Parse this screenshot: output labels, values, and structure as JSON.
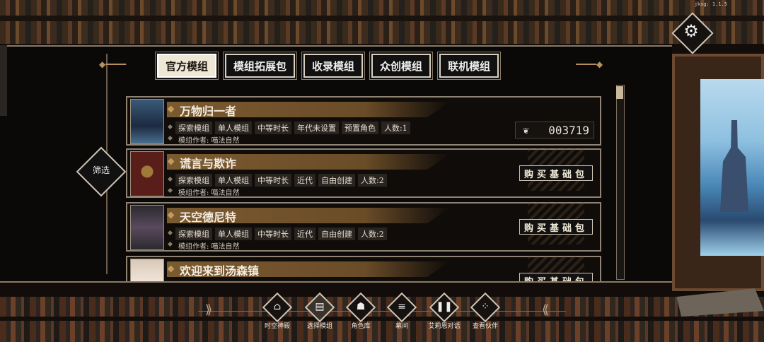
{
  "version": "jksg: 1.1.5",
  "tabs": [
    {
      "label": "官方模组",
      "active": true
    },
    {
      "label": "模组拓展包",
      "active": false
    },
    {
      "label": "收录模组",
      "active": false
    },
    {
      "label": "众创模组",
      "active": false
    },
    {
      "label": "联机模组",
      "active": false
    }
  ],
  "filter_label": "筛选",
  "modules": [
    {
      "title": "万物归一者",
      "tags": [
        "探索模组",
        "单人模组",
        "中等时长",
        "年代未设置",
        "预置角色",
        "人数:1"
      ],
      "author": "模组作者: 喵法自然",
      "counter": "003719",
      "action": ""
    },
    {
      "title": "谎言与欺诈",
      "tags": [
        "探索模组",
        "单人模组",
        "中等时长",
        "近代",
        "自由创建",
        "人数:2"
      ],
      "author": "模组作者: 喵法自然",
      "counter": "",
      "action": "购买基础包"
    },
    {
      "title": "天空德尼特",
      "tags": [
        "探索模组",
        "单人模组",
        "中等时长",
        "近代",
        "自由创建",
        "人数:2"
      ],
      "author": "模组作者: 喵法自然",
      "counter": "",
      "action": "购买基础包"
    },
    {
      "title": "欢迎来到汤森镇",
      "tags": [],
      "author": "",
      "counter": "",
      "action": "购买基础包"
    }
  ],
  "nav": [
    {
      "label": "时空神殿",
      "icon": "temple-icon"
    },
    {
      "label": "选择模组",
      "icon": "cards-icon",
      "active": true
    },
    {
      "label": "角色库",
      "icon": "character-icon"
    },
    {
      "label": "幕间",
      "icon": "interlude-icon"
    },
    {
      "label": "艾莉恩对话",
      "icon": "dialogue-icon"
    },
    {
      "label": "查看伙伴",
      "icon": "partner-icon"
    }
  ],
  "colors": {
    "accent": "#7a5a30",
    "panel": "#0b0908",
    "text": "#f2ece2"
  }
}
